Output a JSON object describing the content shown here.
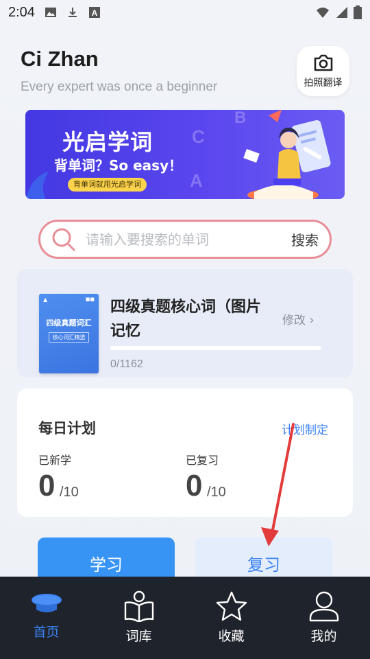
{
  "status_bar": {
    "time": "2:04"
  },
  "header": {
    "title": "Ci Zhan",
    "subtitle": "Every expert was once a beginner",
    "camera_label": "拍照翻译"
  },
  "banner": {
    "title": "光启学词",
    "subtitle": "背单词？So easy！",
    "tag": "背单词就用光启学词",
    "letters": [
      "B",
      "C",
      "A"
    ]
  },
  "search": {
    "placeholder": "请输入要搜索的单词",
    "button_label": "搜索"
  },
  "book": {
    "title": "四级真题核心词（图片记忆",
    "edit_label": "修改",
    "count_text": "0/1162",
    "learned": 0,
    "total": 1162,
    "progress_fraction": 0,
    "cover_title": "四级真题词汇",
    "cover_subtitle": "核心词汇精选"
  },
  "daily_plan": {
    "title": "每日计划",
    "plan_link": "计划制定",
    "new_learned_label": "已新学",
    "new_learned_value": "0",
    "new_learned_total": "/10",
    "reviewed_label": "已复习",
    "reviewed_value": "0",
    "reviewed_total": "/10"
  },
  "actions": {
    "study_label": "学习",
    "review_label": "复习"
  },
  "bottom_nav": {
    "items": [
      {
        "label": "首页",
        "icon": "graduation-cap-icon",
        "active": true
      },
      {
        "label": "词库",
        "icon": "person-book-icon",
        "active": false
      },
      {
        "label": "收藏",
        "icon": "star-icon",
        "active": false
      },
      {
        "label": "我的",
        "icon": "user-icon",
        "active": false
      }
    ]
  },
  "colors": {
    "accent": "#3b82f6",
    "search_border": "#e98d95",
    "nav_bg": "#1f242c",
    "banner": "#4f3fe8",
    "annotation_arrow": "#e23b3b"
  }
}
